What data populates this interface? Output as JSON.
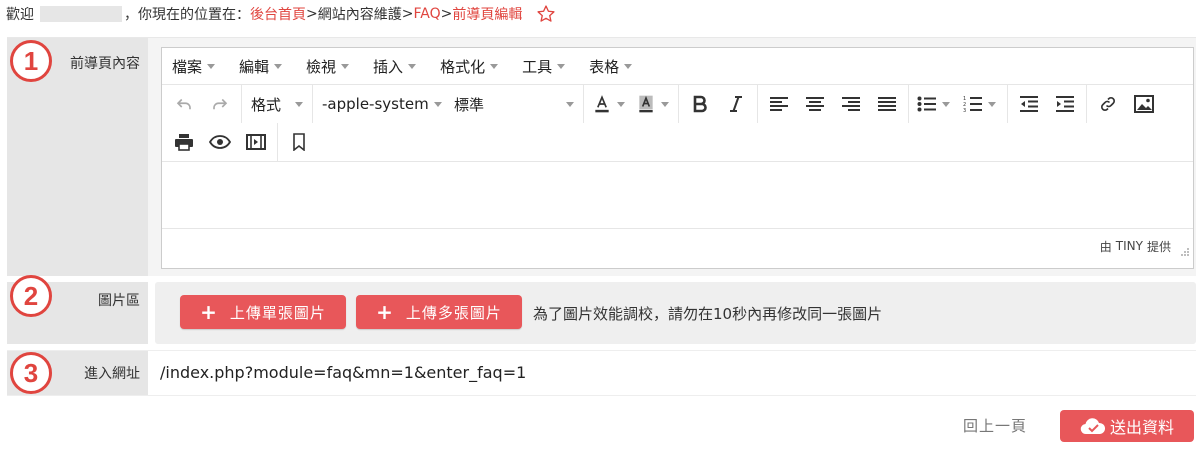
{
  "breadcrumb": {
    "welcome": "歡迎",
    "location_prefix": "，你現在的位置在：",
    "home": "後台首頁",
    "sep1": ">",
    "section": " 網站內容維護 ",
    "sep2": ">",
    "faq": "FAQ",
    "sep3": ">",
    "current": "前導頁編輯"
  },
  "rows": {
    "intro": {
      "number": "1",
      "label": "前導頁內容"
    },
    "images": {
      "number": "2",
      "label": "圖片區"
    },
    "url": {
      "number": "3",
      "label": "進入網址"
    }
  },
  "editor": {
    "menu": [
      "檔案",
      "編輯",
      "檢視",
      "插入",
      "格式化",
      "工具",
      "表格"
    ],
    "format_label": "格式",
    "font_family": "-apple-system",
    "font_size": "標準",
    "status_by": "由",
    "status_brand": "TINY",
    "status_provided": "提供"
  },
  "images": {
    "upload_single": "上傳單張圖片",
    "upload_multi": "上傳多張圖片",
    "note": "為了圖片效能調校，請勿在10秒內再修改同一張圖片"
  },
  "url_value": "/index.php?module=faq&mn=1&enter_faq=1",
  "footer": {
    "back": "回上一頁",
    "submit": "送出資料"
  },
  "colors": {
    "accent": "#e0453f",
    "button": "#e8575a",
    "label_bg": "#e6e6e6"
  },
  "icons": [
    "star-outline-icon",
    "undo-icon",
    "redo-icon",
    "text-color-icon",
    "background-color-icon",
    "bold-icon",
    "italic-icon",
    "align-left-icon",
    "align-center-icon",
    "align-right-icon",
    "align-justify-icon",
    "bullet-list-icon",
    "numbered-list-icon",
    "outdent-icon",
    "indent-icon",
    "link-icon",
    "image-icon",
    "print-icon",
    "preview-icon",
    "media-icon",
    "bookmark-icon",
    "resize-handle-icon",
    "cloud-upload-icon"
  ]
}
